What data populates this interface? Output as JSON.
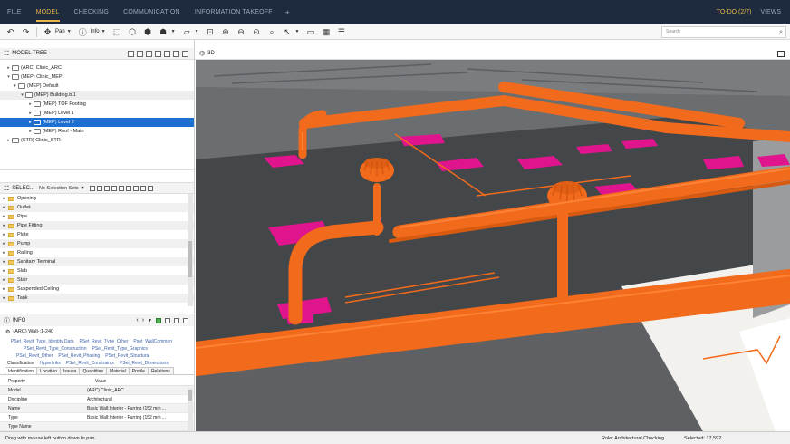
{
  "menu": {
    "tabs": [
      "FILE",
      "MODEL",
      "CHECKING",
      "COMMUNICATION",
      "INFORMATION TAKEOFF"
    ],
    "active_tab": "MODEL",
    "plus": "+",
    "todo": "TO-DO (2/7)",
    "views": "VIEWS"
  },
  "toolbar": {
    "pan_label": "Pan",
    "info_label": "Info",
    "search_placeholder": "Search"
  },
  "model_tree": {
    "title": "MODEL TREE",
    "rows": [
      {
        "label": "(ARC) Clinic_ARC",
        "depth": 0,
        "expanded": false
      },
      {
        "label": "(MEP) Clinic_MEP",
        "depth": 0,
        "expanded": true
      },
      {
        "label": "(MEP) Default",
        "depth": 1,
        "expanded": true
      },
      {
        "label": "(MEP) Building.b.1",
        "depth": 2,
        "expanded": true
      },
      {
        "label": "(MEP) TOF Footing",
        "depth": 3,
        "expanded": false
      },
      {
        "label": "(MEP) Level 1",
        "depth": 3,
        "expanded": false
      },
      {
        "label": "(MEP) Level 2",
        "depth": 3,
        "expanded": false,
        "selected": true
      },
      {
        "label": "(MEP) Roof - Main",
        "depth": 3,
        "expanded": false
      },
      {
        "label": "(STR) Clinic_STR",
        "depth": 0,
        "expanded": false
      }
    ]
  },
  "selection_sets": {
    "title": "SELEC...",
    "dropdown": "No Selection Sets",
    "items": [
      "Opening",
      "Outlet",
      "Pipe",
      "Pipe Fitting",
      "Plate",
      "Pump",
      "Railing",
      "Sanitary Terminal",
      "Slab",
      "Stair",
      "Suspended Ceiling",
      "Tank"
    ]
  },
  "info": {
    "title": "INFO",
    "object": "(ARC) Wall-:1-240",
    "psets": [
      [
        "PSet_Revit_Type_Identity Data",
        "PSet_Revit_Type_Other",
        "Pset_WallCommon"
      ],
      [
        "PSet_Revit_Type_Construction",
        "PSet_Revit_Type_Graphics"
      ],
      [
        "PSet_Revit_Other",
        "PSet_Revit_Phasing",
        "PSet_Revit_Structural"
      ],
      [
        "Classification",
        "Hyperlinks",
        "PSet_Revit_Constraints",
        "PSet_Revit_Dimensions"
      ]
    ],
    "tabs": [
      "Identification",
      "Location",
      "Issues",
      "Quantities",
      "Material",
      "Profile",
      "Relations"
    ],
    "active_tab": "Identification",
    "columns": [
      "Property",
      "Value"
    ],
    "rows": [
      {
        "k": "Model",
        "v": "(ARC) Clinic_ARC"
      },
      {
        "k": "Discipline",
        "v": "Architectural"
      },
      {
        "k": "Name",
        "v": "Basic Wall:Interior - Furring (152 mm ..."
      },
      {
        "k": "Type",
        "v": "Basic Wall:Interior - Furring (152 mm ..."
      },
      {
        "k": "Type Name",
        "v": ""
      }
    ]
  },
  "view": {
    "title": "3D",
    "colors": {
      "pipe": "#f26a1b",
      "duct_pink": "#e0148c",
      "floor": "#3f4144",
      "wall": "#8c8f92"
    }
  },
  "status": {
    "hint": "Drag with mouse left button down to pan.",
    "role": "Role: Architectural Checking",
    "selected": "Selected: 17,592"
  }
}
